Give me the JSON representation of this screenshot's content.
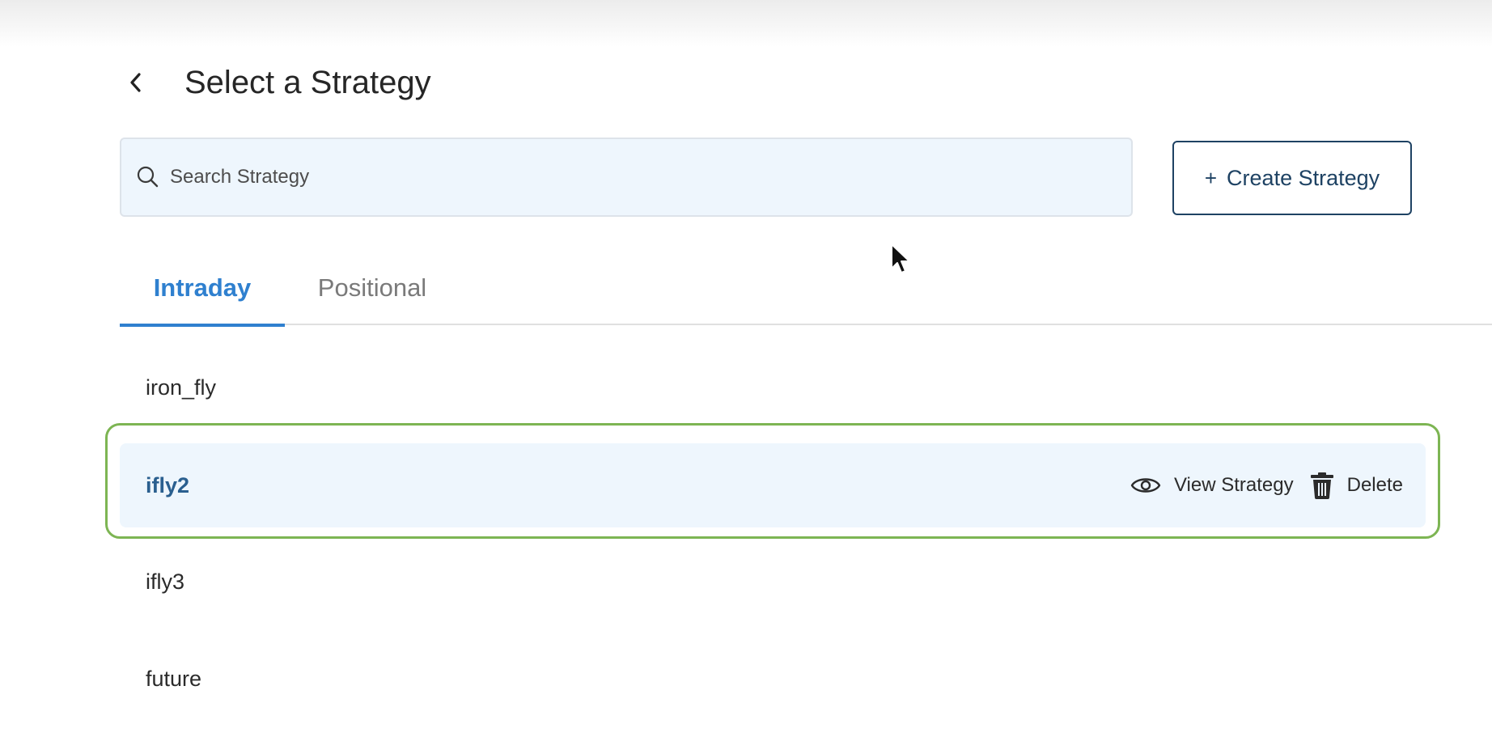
{
  "header": {
    "title": "Select a Strategy",
    "back_icon": "chevron-left-icon"
  },
  "search": {
    "placeholder": "Search Strategy",
    "value": "",
    "icon": "search-icon"
  },
  "create_button": {
    "plus": "+",
    "label": "Create Strategy"
  },
  "tabs": [
    {
      "label": "Intraday",
      "active": true
    },
    {
      "label": "Positional",
      "active": false
    }
  ],
  "strategies": [
    {
      "name": "iron_fly"
    },
    {
      "name": "ifly2",
      "selected": true
    },
    {
      "name": "ifly3"
    },
    {
      "name": "future"
    }
  ],
  "row_actions": {
    "view_label": "View Strategy",
    "view_icon": "eye-icon",
    "delete_label": "Delete",
    "delete_icon": "trash-icon"
  },
  "colors": {
    "accent": "#2f80cf",
    "primary_dark": "#1e4263",
    "selected_bg": "#eef6fd",
    "highlight_border": "#7db553"
  }
}
